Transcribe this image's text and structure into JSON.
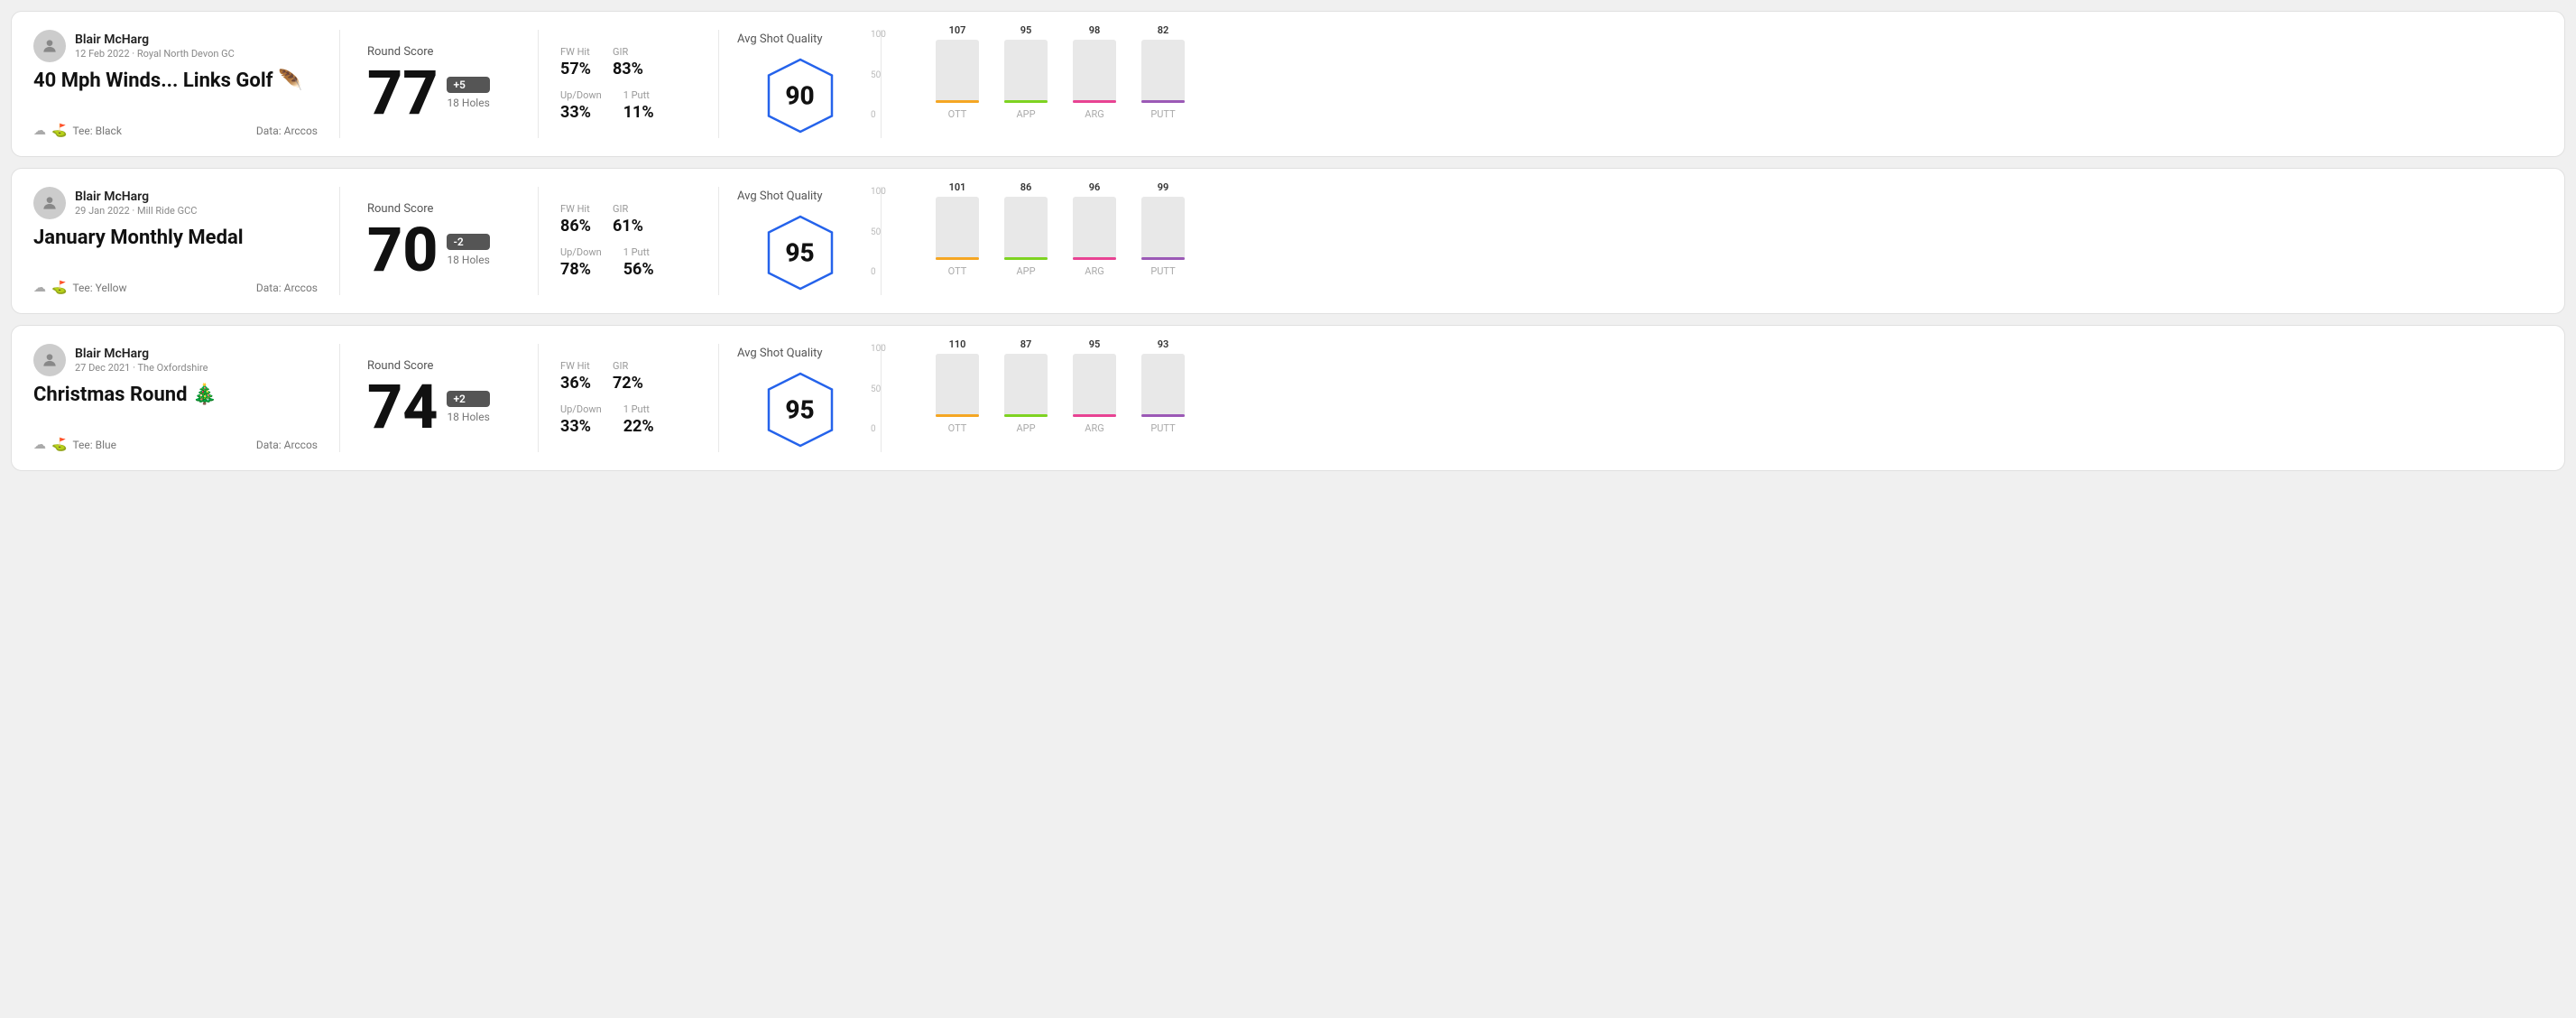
{
  "rounds": [
    {
      "id": "round1",
      "user": {
        "name": "Blair McHarg",
        "date_course": "12 Feb 2022 · Royal North Devon GC"
      },
      "title": "40 Mph Winds... Links Golf 🪶",
      "tee": "Black",
      "data_source": "Data: Arccos",
      "round_score_label": "Round Score",
      "score": "77",
      "score_diff": "+5",
      "holes": "18 Holes",
      "fw_hit_label": "FW Hit",
      "fw_hit_value": "57%",
      "gir_label": "GIR",
      "gir_value": "83%",
      "updown_label": "Up/Down",
      "updown_value": "33%",
      "oneputt_label": "1 Putt",
      "oneputt_value": "11%",
      "quality_label": "Avg Shot Quality",
      "quality_score": "90",
      "chart": {
        "ott": {
          "label": "OTT",
          "value": 107,
          "color": "#f5a623"
        },
        "app": {
          "label": "APP",
          "value": 95,
          "color": "#7ed321"
        },
        "arg": {
          "label": "ARG",
          "value": 98,
          "color": "#e84393"
        },
        "putt": {
          "label": "PUTT",
          "value": 82,
          "color": "#9b59b6"
        }
      },
      "chart_max": 100,
      "chart_mid": 50
    },
    {
      "id": "round2",
      "user": {
        "name": "Blair McHarg",
        "date_course": "29 Jan 2022 · Mill Ride GCC"
      },
      "title": "January Monthly Medal",
      "tee": "Yellow",
      "data_source": "Data: Arccos",
      "round_score_label": "Round Score",
      "score": "70",
      "score_diff": "-2",
      "holes": "18 Holes",
      "fw_hit_label": "FW Hit",
      "fw_hit_value": "86%",
      "gir_label": "GIR",
      "gir_value": "61%",
      "updown_label": "Up/Down",
      "updown_value": "78%",
      "oneputt_label": "1 Putt",
      "oneputt_value": "56%",
      "quality_label": "Avg Shot Quality",
      "quality_score": "95",
      "chart": {
        "ott": {
          "label": "OTT",
          "value": 101,
          "color": "#f5a623"
        },
        "app": {
          "label": "APP",
          "value": 86,
          "color": "#7ed321"
        },
        "arg": {
          "label": "ARG",
          "value": 96,
          "color": "#e84393"
        },
        "putt": {
          "label": "PUTT",
          "value": 99,
          "color": "#9b59b6"
        }
      },
      "chart_max": 100,
      "chart_mid": 50
    },
    {
      "id": "round3",
      "user": {
        "name": "Blair McHarg",
        "date_course": "27 Dec 2021 · The Oxfordshire"
      },
      "title": "Christmas Round 🎄",
      "tee": "Blue",
      "data_source": "Data: Arccos",
      "round_score_label": "Round Score",
      "score": "74",
      "score_diff": "+2",
      "holes": "18 Holes",
      "fw_hit_label": "FW Hit",
      "fw_hit_value": "36%",
      "gir_label": "GIR",
      "gir_value": "72%",
      "updown_label": "Up/Down",
      "updown_value": "33%",
      "oneputt_label": "1 Putt",
      "oneputt_value": "22%",
      "quality_label": "Avg Shot Quality",
      "quality_score": "95",
      "chart": {
        "ott": {
          "label": "OTT",
          "value": 110,
          "color": "#f5a623"
        },
        "app": {
          "label": "APP",
          "value": 87,
          "color": "#7ed321"
        },
        "arg": {
          "label": "ARG",
          "value": 95,
          "color": "#e84393"
        },
        "putt": {
          "label": "PUTT",
          "value": 93,
          "color": "#9b59b6"
        }
      },
      "chart_max": 100,
      "chart_mid": 50
    }
  ]
}
